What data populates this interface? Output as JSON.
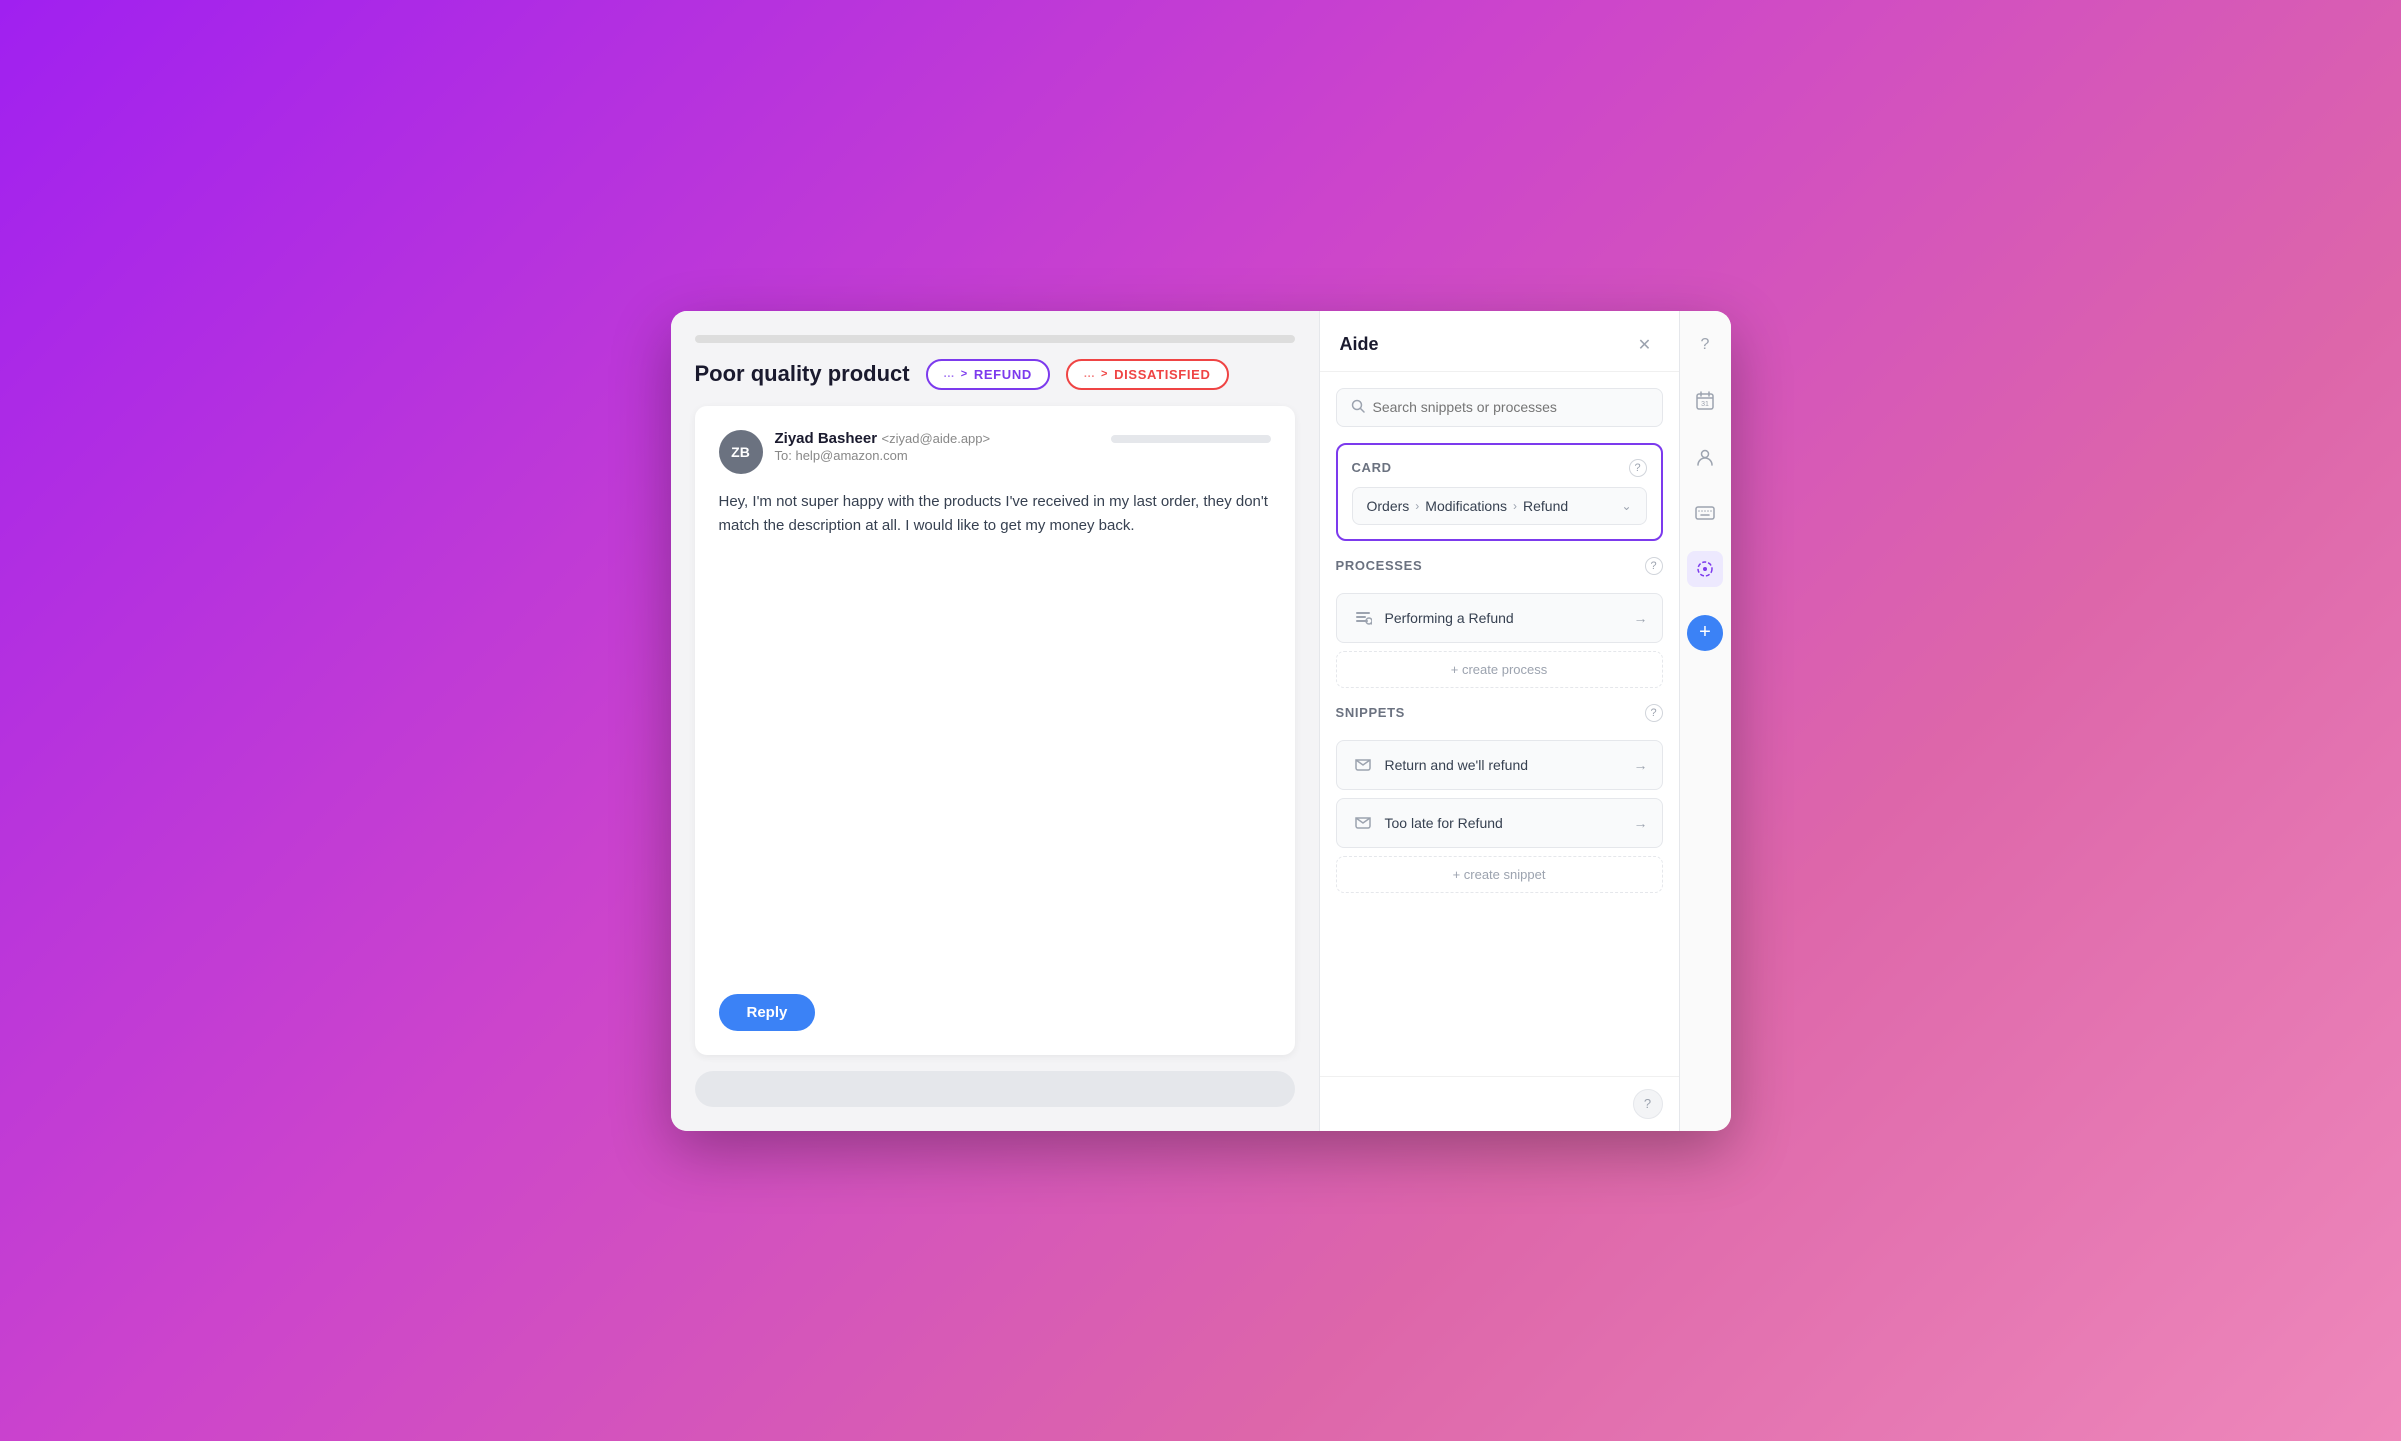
{
  "window": {
    "title": "Aide"
  },
  "left": {
    "subject": "Poor quality product",
    "tag_refund_dots": "...",
    "tag_refund_arrow": ">",
    "tag_refund_label": "REFUND",
    "tag_dissatisfied_dots": "...",
    "tag_dissatisfied_arrow": ">",
    "tag_dissatisfied_label": "DISSATISFIED",
    "email": {
      "avatar": "ZB",
      "sender_name": "Ziyad Basheer",
      "sender_email": "<ziyad@aide.app>",
      "to_label": "To:",
      "to_address": "help@amazon.com",
      "body": "Hey, I'm not super happy with the products I've received  in my last order, they don't match the description at all. I would like to get my money back.",
      "reply_label": "Reply"
    }
  },
  "right": {
    "title": "Aide",
    "search_placeholder": "Search snippets or processes",
    "card": {
      "label": "Card",
      "breadcrumb": {
        "orders": "Orders",
        "modifications": "Modifications",
        "refund": "Refund"
      }
    },
    "processes": {
      "label": "Processes",
      "items": [
        {
          "name": "Performing a Refund"
        }
      ],
      "create_label": "+ create process"
    },
    "snippets": {
      "label": "Snippets",
      "items": [
        {
          "name": "Return and we'll refund"
        },
        {
          "name": "Too late for Refund"
        }
      ],
      "create_label": "+ create snippet"
    }
  },
  "icons": {
    "close": "✕",
    "help": "?",
    "calendar": "31",
    "person": "👤",
    "keyboard": "⌨",
    "circle": "◎",
    "add": "+",
    "search": "🔍",
    "process": "≡",
    "chat": "💬",
    "arrow_right": "→",
    "chevron_down": "⌄"
  }
}
